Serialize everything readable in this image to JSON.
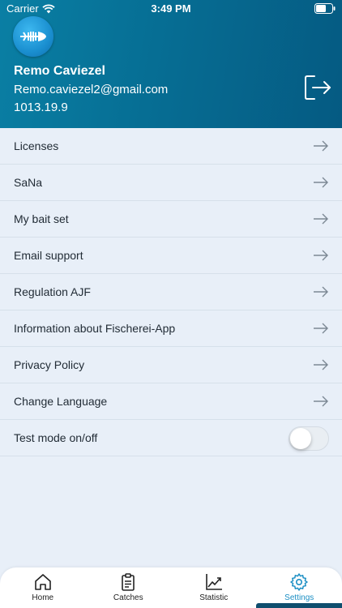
{
  "status": {
    "carrier": "Carrier",
    "time": "3:49 PM"
  },
  "user": {
    "name": "Remo Caviezel",
    "email": "Remo.caviezel2@gmail.com",
    "version": "1013.19.9"
  },
  "menu": {
    "items": [
      {
        "label": "Licenses"
      },
      {
        "label": "SaNa"
      },
      {
        "label": "My bait set"
      },
      {
        "label": "Email support"
      },
      {
        "label": "Regulation AJF"
      },
      {
        "label": "Information about Fischerei-App"
      },
      {
        "label": "Privacy Policy"
      },
      {
        "label": "Change Language"
      }
    ],
    "test_mode": {
      "label": "Test mode on/off",
      "enabled": false
    }
  },
  "tabs": [
    {
      "label": "Home",
      "icon": "home-icon",
      "active": false
    },
    {
      "label": "Catches",
      "icon": "clipboard-icon",
      "active": false
    },
    {
      "label": "Statistic",
      "icon": "chart-icon",
      "active": false
    },
    {
      "label": "Settings",
      "icon": "gear-icon",
      "active": true
    }
  ],
  "colors": {
    "header_start": "#0a7fa4",
    "header_end": "#055a82",
    "background": "#e8eff8",
    "active_tab": "#1c8fc4"
  }
}
